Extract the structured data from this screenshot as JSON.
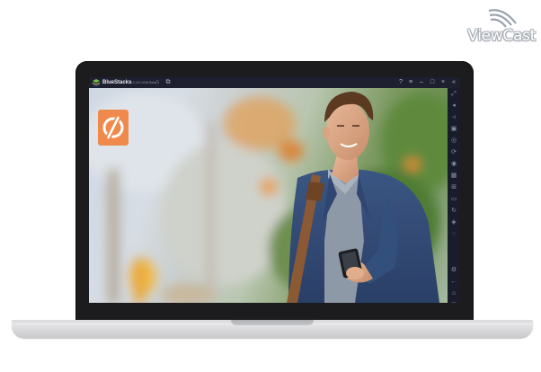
{
  "watermark": {
    "text": "ViewCast"
  },
  "window": {
    "app_name": "BlueStacks",
    "version": "5.9.110.1038 Beta"
  },
  "titlebar_icons": [
    "home-icon",
    "multi-instance-icon",
    "help-icon",
    "menu-icon",
    "minimize-icon",
    "maximize-icon",
    "close-icon",
    "collapse-sidebar-icon"
  ],
  "sidebar_icons": [
    "fullscreen-icon",
    "volume-up-icon",
    "volume-down-icon",
    "media-icon",
    "gamepad-icon",
    "macro-icon",
    "screenshot-icon",
    "record-icon",
    "install-apk-icon",
    "folder-icon",
    "rotate-icon",
    "shake-icon",
    "eco-mode-icon",
    "settings-icon",
    "back-icon",
    "home-nav-icon",
    "recents-icon"
  ],
  "app": {
    "icon_color": "#ef8a4c",
    "scene": "man-smiling-at-phone-photo"
  },
  "colors": {
    "titlebar": "#1e2030",
    "sidebar": "#1a1c29",
    "bezel": "#1c1c1e"
  }
}
